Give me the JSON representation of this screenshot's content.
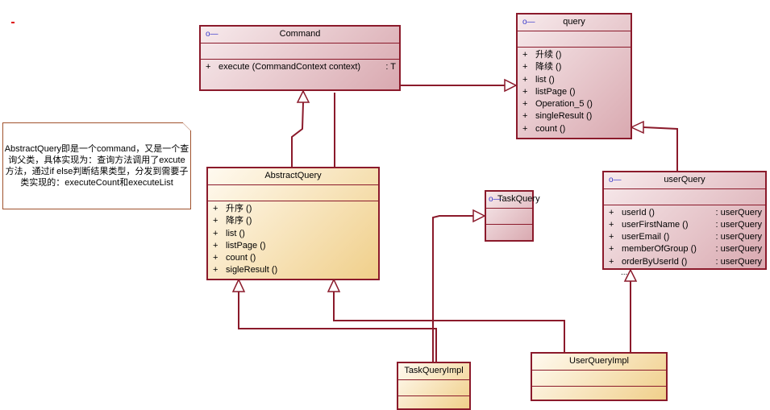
{
  "note": {
    "text": "AbstractQuery即是一个command，又是一个查询父类，具体实现为：查询方法调用了excute方法，通过if else判断结果类型，分发到需要子类实现的：executeCount和executeList"
  },
  "classes": {
    "command": {
      "name": "Command",
      "ops": [
        {
          "v": "+",
          "n": "execute (CommandContext context)",
          "t": ": T"
        }
      ]
    },
    "query": {
      "name": "query",
      "ops": [
        {
          "v": "+",
          "n": "升续 ()"
        },
        {
          "v": "+",
          "n": "降续 ()"
        },
        {
          "v": "+",
          "n": "list ()"
        },
        {
          "v": "+",
          "n": "listPage ()"
        },
        {
          "v": "+",
          "n": "Operation_5 ()"
        },
        {
          "v": "+",
          "n": "singleResult ()"
        },
        {
          "v": "+",
          "n": "count ()"
        }
      ]
    },
    "abstractQuery": {
      "name": "AbstractQuery",
      "ops": [
        {
          "v": "+",
          "n": "升序 ()"
        },
        {
          "v": "+",
          "n": "降序 ()"
        },
        {
          "v": "+",
          "n": "list ()"
        },
        {
          "v": "+",
          "n": "listPage ()"
        },
        {
          "v": "+",
          "n": "count ()"
        },
        {
          "v": "+",
          "n": "sigleResult ()"
        }
      ]
    },
    "taskQuery": {
      "name": "TaskQuery"
    },
    "userQuery": {
      "name": "userQuery",
      "ops": [
        {
          "v": "+",
          "n": "userId ()",
          "t": ": userQuery"
        },
        {
          "v": "+",
          "n": "userFirstName ()",
          "t": ": userQuery"
        },
        {
          "v": "+",
          "n": "userEmail ()",
          "t": ": userQuery"
        },
        {
          "v": "+",
          "n": "memberOfGroup ()",
          "t": ": userQuery"
        },
        {
          "v": "+",
          "n": "orderByUserId ()",
          "t": ": userQuery"
        }
      ],
      "more": "..."
    },
    "taskQueryImpl": {
      "name": "TaskQueryImpl"
    },
    "userQueryImpl": {
      "name": "UserQueryImpl"
    }
  },
  "colors": {
    "line": "#8b1a2b",
    "interface_fill": "#e6c3c8",
    "class_fill": "#f5dfa8"
  },
  "icons": {
    "interface": "interface-lollipop-icon"
  }
}
